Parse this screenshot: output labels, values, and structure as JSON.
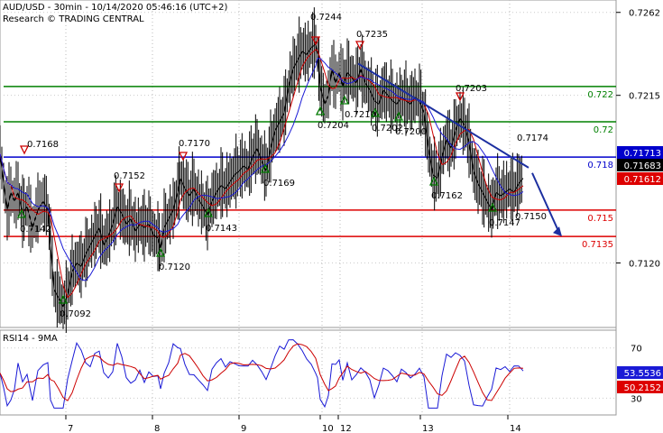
{
  "header": {
    "line1": "AUD/USD - 30min - 10/14/2020 05:46:16 (UTC+2)",
    "line2": "Research © TRADING CENTRAL"
  },
  "rsi_title": "RSI14 - 9MA",
  "colors": {
    "price": "#000000",
    "ma_fast": "#cc0000",
    "ma_slow": "#1a1ad6",
    "green_level": "#008000",
    "blue_level": "#0000cc",
    "red_level": "#dd0000",
    "trend": "#1c2fa0",
    "tri_up": "#007a00",
    "tri_down": "#cc0000"
  },
  "chart_data": {
    "type": "line",
    "instrument": "AUD/USD",
    "timeframe": "30min",
    "price_axis": {
      "range": [
        0.7085,
        0.7268
      ],
      "ticks": [
        "0.7262",
        "0.7215",
        "0.7120"
      ]
    },
    "x_tick_labels": [
      "7",
      "8",
      "9",
      "10",
      "12",
      "13",
      "14"
    ],
    "horizontal_levels": [
      {
        "value": 0.722,
        "label": "0.722",
        "color": "green"
      },
      {
        "value": 0.72,
        "label": "0.72",
        "color": "green"
      },
      {
        "value": 0.718,
        "label": "0.718",
        "color": "blue"
      },
      {
        "value": 0.715,
        "label": "0.715",
        "color": "red"
      },
      {
        "value": 0.7135,
        "label": "0.7135",
        "color": "red"
      }
    ],
    "price_badges": [
      {
        "label": "0.71713",
        "color": "blue"
      },
      {
        "label": "0.71683",
        "color": "black"
      },
      {
        "label": "0.71612",
        "color": "red"
      }
    ],
    "swing_annotations": [
      {
        "label": "0.7168",
        "kind": "high"
      },
      {
        "label": "0.7142",
        "kind": "low"
      },
      {
        "label": "0.7092",
        "kind": "low"
      },
      {
        "label": "0.7152",
        "kind": "high"
      },
      {
        "label": "0.7120",
        "kind": "low"
      },
      {
        "label": "0.7170",
        "kind": "high"
      },
      {
        "label": "0.7143",
        "kind": "low"
      },
      {
        "label": "0.7169",
        "kind": "low"
      },
      {
        "label": "0.7244",
        "kind": "high"
      },
      {
        "label": "0.7204",
        "kind": "low"
      },
      {
        "label": "0.7235",
        "kind": "high"
      },
      {
        "label": "0.7210",
        "kind": "low"
      },
      {
        "label": "0.7202",
        "kind": "low"
      },
      {
        "label": "0.7200",
        "kind": "low"
      },
      {
        "label": "0.7162",
        "kind": "low"
      },
      {
        "label": "0.7203",
        "kind": "high"
      },
      {
        "label": "0.7174",
        "kind": "high"
      },
      {
        "label": "0.7147",
        "kind": "low"
      },
      {
        "label": "0.7150",
        "kind": "low"
      }
    ],
    "price_series": [
      [
        0,
        0.7182
      ],
      [
        4,
        0.7165
      ],
      [
        8,
        0.715
      ],
      [
        12,
        0.716
      ],
      [
        16,
        0.7155
      ],
      [
        20,
        0.716
      ],
      [
        25,
        0.7148
      ],
      [
        30,
        0.7152
      ],
      [
        36,
        0.714
      ],
      [
        42,
        0.715
      ],
      [
        48,
        0.7155
      ],
      [
        53,
        0.715
      ],
      [
        56,
        0.713
      ],
      [
        60,
        0.7105
      ],
      [
        65,
        0.71
      ],
      [
        70,
        0.7095
      ],
      [
        75,
        0.7102
      ],
      [
        80,
        0.7115
      ],
      [
        85,
        0.712
      ],
      [
        90,
        0.7118
      ],
      [
        95,
        0.7125
      ],
      [
        100,
        0.713
      ],
      [
        105,
        0.7135
      ],
      [
        110,
        0.714
      ],
      [
        115,
        0.713
      ],
      [
        120,
        0.7135
      ],
      [
        125,
        0.7142
      ],
      [
        130,
        0.7152
      ],
      [
        135,
        0.7148
      ],
      [
        140,
        0.7142
      ],
      [
        145,
        0.7145
      ],
      [
        150,
        0.7138
      ],
      [
        155,
        0.7142
      ],
      [
        160,
        0.714
      ],
      [
        165,
        0.7142
      ],
      [
        170,
        0.7136
      ],
      [
        175,
        0.7134
      ],
      [
        178,
        0.7128
      ],
      [
        182,
        0.714
      ],
      [
        187,
        0.7145
      ],
      [
        192,
        0.715
      ],
      [
        197,
        0.716
      ],
      [
        200,
        0.7168
      ],
      [
        205,
        0.7162
      ],
      [
        210,
        0.7158
      ],
      [
        215,
        0.7162
      ],
      [
        220,
        0.7156
      ],
      [
        225,
        0.7152
      ],
      [
        230,
        0.7147
      ],
      [
        235,
        0.7155
      ],
      [
        240,
        0.716
      ],
      [
        245,
        0.7164
      ],
      [
        250,
        0.7162
      ],
      [
        255,
        0.7166
      ],
      [
        260,
        0.717
      ],
      [
        265,
        0.7172
      ],
      [
        270,
        0.7175
      ],
      [
        275,
        0.7173
      ],
      [
        280,
        0.718
      ],
      [
        285,
        0.7185
      ],
      [
        290,
        0.7178
      ],
      [
        295,
        0.7172
      ],
      [
        300,
        0.7185
      ],
      [
        305,
        0.7195
      ],
      [
        310,
        0.72
      ],
      [
        315,
        0.7205
      ],
      [
        320,
        0.722
      ],
      [
        325,
        0.723
      ],
      [
        330,
        0.7235
      ],
      [
        335,
        0.724
      ],
      [
        340,
        0.7238
      ],
      [
        345,
        0.7242
      ],
      [
        350,
        0.7244
      ],
      [
        352,
        0.7238
      ],
      [
        355,
        0.722
      ],
      [
        360,
        0.721
      ],
      [
        364,
        0.7215
      ],
      [
        368,
        0.723
      ],
      [
        372,
        0.7222
      ],
      [
        376,
        0.7228
      ],
      [
        380,
        0.722
      ],
      [
        385,
        0.7228
      ],
      [
        390,
        0.7225
      ],
      [
        395,
        0.7222
      ],
      [
        400,
        0.723
      ],
      [
        405,
        0.7222
      ],
      [
        410,
        0.7218
      ],
      [
        415,
        0.7212
      ],
      [
        420,
        0.721
      ],
      [
        425,
        0.7218
      ],
      [
        430,
        0.7215
      ],
      [
        435,
        0.7212
      ],
      [
        440,
        0.721
      ],
      [
        445,
        0.7214
      ],
      [
        450,
        0.7212
      ],
      [
        455,
        0.721
      ],
      [
        460,
        0.7214
      ],
      [
        465,
        0.7212
      ],
      [
        470,
        0.7205
      ],
      [
        475,
        0.7185
      ],
      [
        480,
        0.717
      ],
      [
        485,
        0.7168
      ],
      [
        490,
        0.718
      ],
      [
        495,
        0.719
      ],
      [
        500,
        0.7185
      ],
      [
        505,
        0.7195
      ],
      [
        510,
        0.7202
      ],
      [
        515,
        0.7198
      ],
      [
        520,
        0.7188
      ],
      [
        525,
        0.7172
      ],
      [
        530,
        0.7165
      ],
      [
        535,
        0.716
      ],
      [
        540,
        0.7155
      ],
      [
        545,
        0.715
      ],
      [
        550,
        0.716
      ],
      [
        555,
        0.7158
      ],
      [
        560,
        0.716
      ],
      [
        565,
        0.7162
      ],
      [
        570,
        0.716
      ],
      [
        575,
        0.7165
      ],
      [
        580,
        0.7168
      ]
    ],
    "trend_line": {
      "from": [
        0.7233,
        397
      ],
      "to": [
        0.7174,
        586
      ]
    },
    "projection_arrow": {
      "from": [
        0.7171,
        590
      ],
      "to": [
        0.7135,
        623
      ]
    },
    "rsi_panel": {
      "title": "RSI14 - 9MA",
      "ticks": [
        "70",
        "30"
      ],
      "range": [
        18,
        82
      ],
      "badges": [
        "53.5536",
        "50.2152"
      ]
    }
  }
}
